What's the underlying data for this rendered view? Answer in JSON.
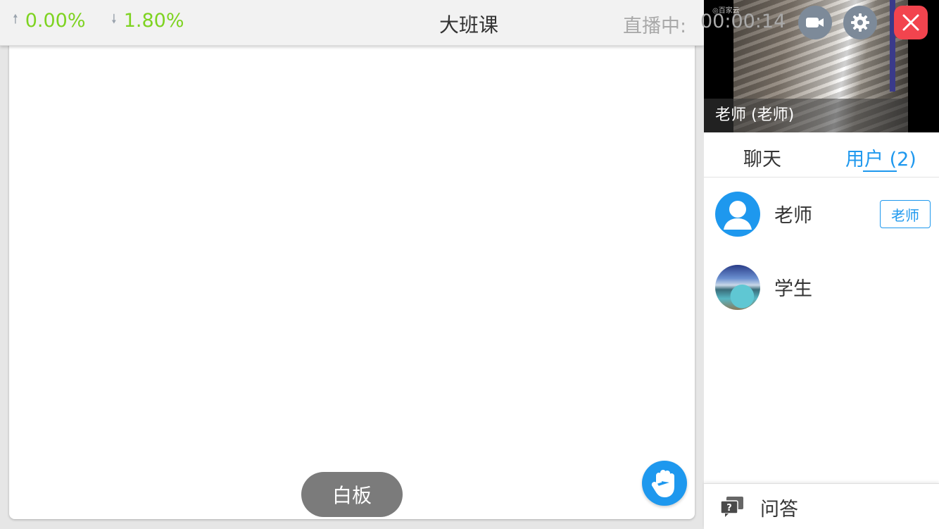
{
  "topbar": {
    "upload_stat": "0.00%",
    "download_stat": "1.80%",
    "title": "大班课",
    "live_label": "直播中:",
    "timer": "00:00:14"
  },
  "controls": {
    "camera_icon": "video-camera-icon",
    "settings_icon": "gear-icon",
    "close_icon": "close-icon"
  },
  "video": {
    "caption": "老师 (老师)"
  },
  "tabs": {
    "chat": "聊天",
    "users": "用户 (2)"
  },
  "users": [
    {
      "name": "老师",
      "badge": "老师"
    },
    {
      "name": "学生"
    }
  ],
  "board": {
    "whiteboard_label": "白板"
  },
  "qa": {
    "label": "问答"
  },
  "colors": {
    "accent": "#1e98ee",
    "stat_green": "#7ed321",
    "close_red": "#f2444e",
    "control_grey": "#7d8a99"
  }
}
